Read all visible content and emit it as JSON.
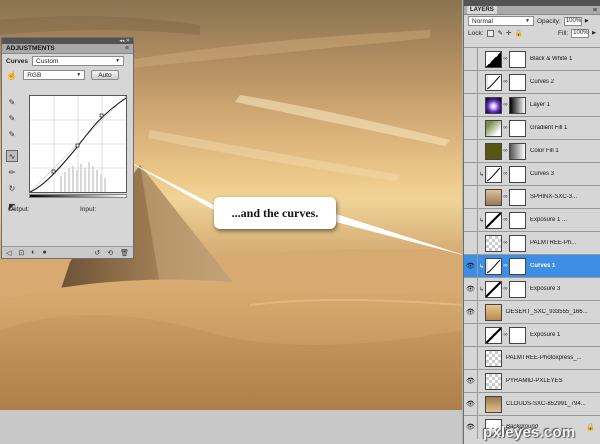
{
  "adjustments": {
    "tab_label": "ADJUSTMENTS",
    "mode_label": "Curves",
    "preset_value": "Custom",
    "channel_value": "RGB",
    "auto_button": "Auto",
    "output_label": "Output:",
    "input_label": "Input:"
  },
  "callout_text": "...and the curves.",
  "layers_panel": {
    "tab_label": "LAYERS",
    "blend_mode": "Normal",
    "opacity_label": "Opacity:",
    "opacity_value": "100%",
    "lock_label": "Lock:",
    "fill_label": "Fill:",
    "fill_value": "100%",
    "layers": [
      {
        "name": "Black & White 1",
        "visible": false,
        "thumb": "th-bw",
        "mask": true,
        "clip": false,
        "selected": false,
        "italic": false
      },
      {
        "name": "Curves 2",
        "visible": false,
        "thumb": "th-curve",
        "mask": true,
        "clip": false,
        "selected": false,
        "italic": false
      },
      {
        "name": "Layer 1",
        "visible": false,
        "thumb": "th-purple",
        "mask": true,
        "maskStyle": "m-grad",
        "clip": false,
        "selected": false,
        "italic": false
      },
      {
        "name": "Gradient Fill 1",
        "visible": false,
        "thumb": "th-gradfill",
        "mask": true,
        "clip": false,
        "selected": false,
        "italic": false
      },
      {
        "name": "Color Fill 1",
        "visible": false,
        "thumb": "th-olive",
        "mask": true,
        "maskStyle": "m-gray",
        "clip": false,
        "selected": false,
        "italic": false
      },
      {
        "name": "Curves 3",
        "visible": false,
        "thumb": "th-curve",
        "mask": true,
        "clip": true,
        "selected": false,
        "italic": false
      },
      {
        "name": "SPHINX-SXC-3...",
        "visible": false,
        "thumb": "th-sphinx",
        "mask": true,
        "clip": false,
        "selected": false,
        "italic": false
      },
      {
        "name": "Exposure 1 ...",
        "visible": false,
        "thumb": "th-exp",
        "mask": true,
        "clip": true,
        "selected": false,
        "italic": false
      },
      {
        "name": "PALMTREE-Ph...",
        "visible": false,
        "thumb": "th-checker",
        "mask": true,
        "clip": false,
        "selected": false,
        "italic": false
      },
      {
        "name": "Curves 1",
        "visible": true,
        "thumb": "th-curve",
        "mask": true,
        "clip": true,
        "selected": true,
        "italic": false
      },
      {
        "name": "Exposure 3",
        "visible": true,
        "thumb": "th-exp",
        "mask": true,
        "clip": true,
        "selected": false,
        "italic": false
      },
      {
        "name": "DESERT_SXC_933555_166...",
        "visible": true,
        "thumb": "th-desert",
        "mask": false,
        "clip": false,
        "selected": false,
        "italic": false
      },
      {
        "name": "Exposure 1",
        "visible": false,
        "thumb": "th-exp",
        "mask": true,
        "clip": false,
        "selected": false,
        "italic": false
      },
      {
        "name": "PALMTREE-Photoxpress_...",
        "visible": false,
        "thumb": "th-checker",
        "mask": false,
        "clip": false,
        "selected": false,
        "italic": false
      },
      {
        "name": "PYRAMID-PXLEYES",
        "visible": true,
        "thumb": "th-checker",
        "mask": false,
        "clip": false,
        "selected": false,
        "italic": false
      },
      {
        "name": "CLOUDS-SXC-852991_794...",
        "visible": true,
        "thumb": "th-clouds",
        "mask": false,
        "clip": false,
        "selected": false,
        "italic": false
      },
      {
        "name": "Background",
        "visible": true,
        "thumb": "th-bg",
        "mask": false,
        "clip": false,
        "selected": false,
        "italic": true,
        "locked": true
      }
    ]
  },
  "watermark": "pxleyes.com"
}
